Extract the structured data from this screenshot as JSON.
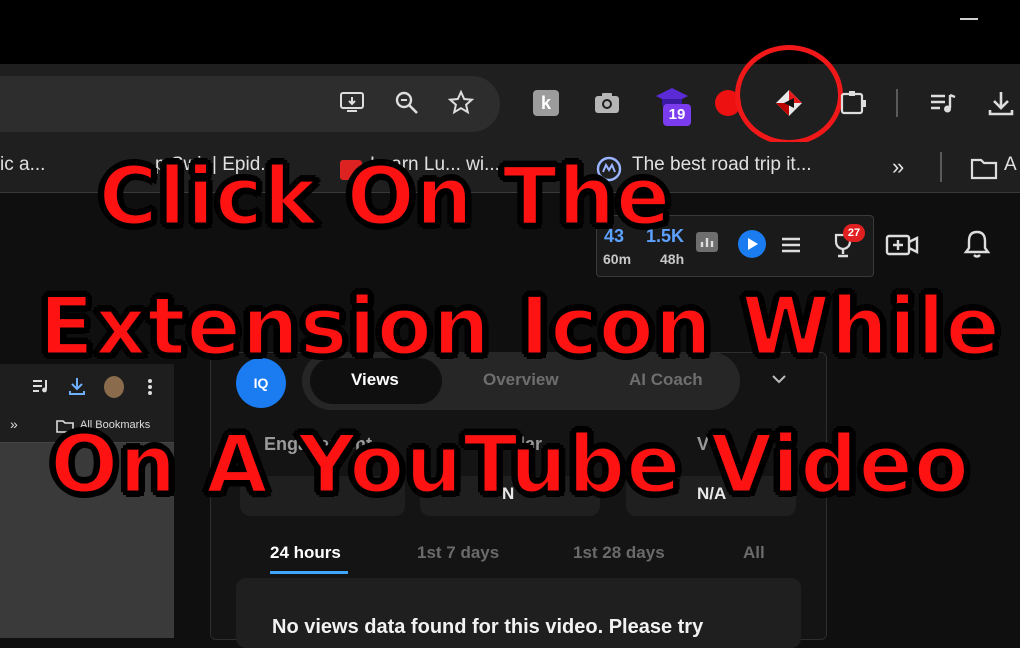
{
  "window": {
    "minimize_label": "–"
  },
  "toolbar": {
    "extension_badge_count": "19",
    "ext_k_letter": "k"
  },
  "bookmarks": {
    "items": [
      {
        "label": "ic a..."
      },
      {
        "label": "p Swi..| Epid..."
      },
      {
        "label": "Learn Lu... wi..."
      },
      {
        "label": "The best road trip it..."
      }
    ],
    "overflow": "»",
    "folder_label": "A"
  },
  "yt_stats": {
    "views": "43",
    "views_period": "60m",
    "views2": "1.5K",
    "views2_period": "48h",
    "trophy_badge": "27"
  },
  "inset": {
    "overflow": "»",
    "bookmarks_label": "All Bookmarks"
  },
  "vidiq": {
    "logo": "IQ",
    "tabs": [
      {
        "label": "Views",
        "active": true
      },
      {
        "label": "Overview",
        "active": false
      },
      {
        "label": "AI Coach",
        "active": false
      }
    ],
    "metrics": [
      {
        "label": "Engagement",
        "value": ""
      },
      {
        "label": "ilar",
        "value": "N"
      },
      {
        "label": "V",
        "value": "N/A"
      }
    ],
    "ranges": [
      "24 hours",
      "1st 7 days",
      "1st 28 days",
      "All"
    ],
    "no_data_message": "No views data found for this video. Please try"
  },
  "caption": {
    "line1": "Click On The",
    "line2": "Extension Icon While",
    "line3": "On A YouTube Video"
  },
  "colors": {
    "caption": "#ff1212",
    "highlight": "#f01818",
    "vidiq_blue": "#1a7cf0",
    "stat_blue": "#5ea2ff"
  }
}
